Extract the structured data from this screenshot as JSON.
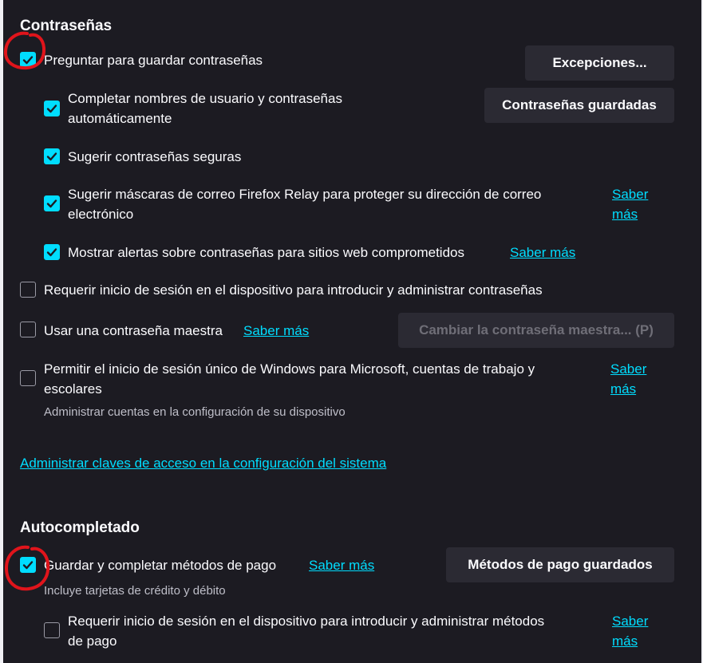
{
  "passwords": {
    "heading": "Contraseñas",
    "ask_to_save": {
      "label": "Preguntar para guardar contraseñas",
      "checked": true
    },
    "exceptions_button": "Excepciones...",
    "autofill": {
      "line1": "Completar nombres de usuario y contraseñas",
      "line2": "automáticamente",
      "checked": true
    },
    "saved_passwords_button": "Contraseñas guardadas",
    "suggest_strong": {
      "label": "Sugerir contraseñas seguras",
      "checked": true
    },
    "relay": {
      "line1": "Sugerir máscaras de correo Firefox Relay para proteger su dirección de correo",
      "line2": "electrónico",
      "checked": true,
      "link_line1": "Saber",
      "link_line2": "más"
    },
    "breach_alerts": {
      "label": "Mostrar alertas sobre contraseñas para sitios web comprometidos",
      "checked": true,
      "link": "Saber más"
    },
    "require_os_auth": {
      "label": "Requerir inicio de sesión en el dispositivo para introducir y administrar contraseñas",
      "checked": false
    },
    "primary_password": {
      "label": "Usar una contraseña maestra",
      "checked": false,
      "link": "Saber más",
      "change_button": "Cambiar la contraseña maestra... (P)"
    },
    "windows_sso": {
      "line1": "Permitir el inicio de sesión único de Windows para Microsoft, cuentas de trabajo y",
      "line2": "escolares",
      "checked": false,
      "link_line1": "Saber",
      "link_line2": "más",
      "sub": "Administrar cuentas en la configuración de su dispositivo"
    },
    "passkeys_link": "Administrar claves de acceso en la configuración del sistema"
  },
  "autofill": {
    "heading": "Autocompletado",
    "payment": {
      "label": "Guardar y completar métodos de pago",
      "checked": true,
      "link": "Saber más",
      "sub": "Incluye tarjetas de crédito y débito"
    },
    "saved_payment_button": "Métodos de pago guardados",
    "require_os_auth_payment": {
      "line1": "Requerir inicio de sesión en el dispositivo para introducir y administrar métodos",
      "line2": "de pago",
      "checked": false,
      "link_line1": "Saber",
      "link_line2": "más"
    }
  },
  "colors": {
    "background": "#1c1b22",
    "accent": "#00ddff",
    "button_bg": "#2b2a33",
    "annotation": "#e0141b"
  }
}
